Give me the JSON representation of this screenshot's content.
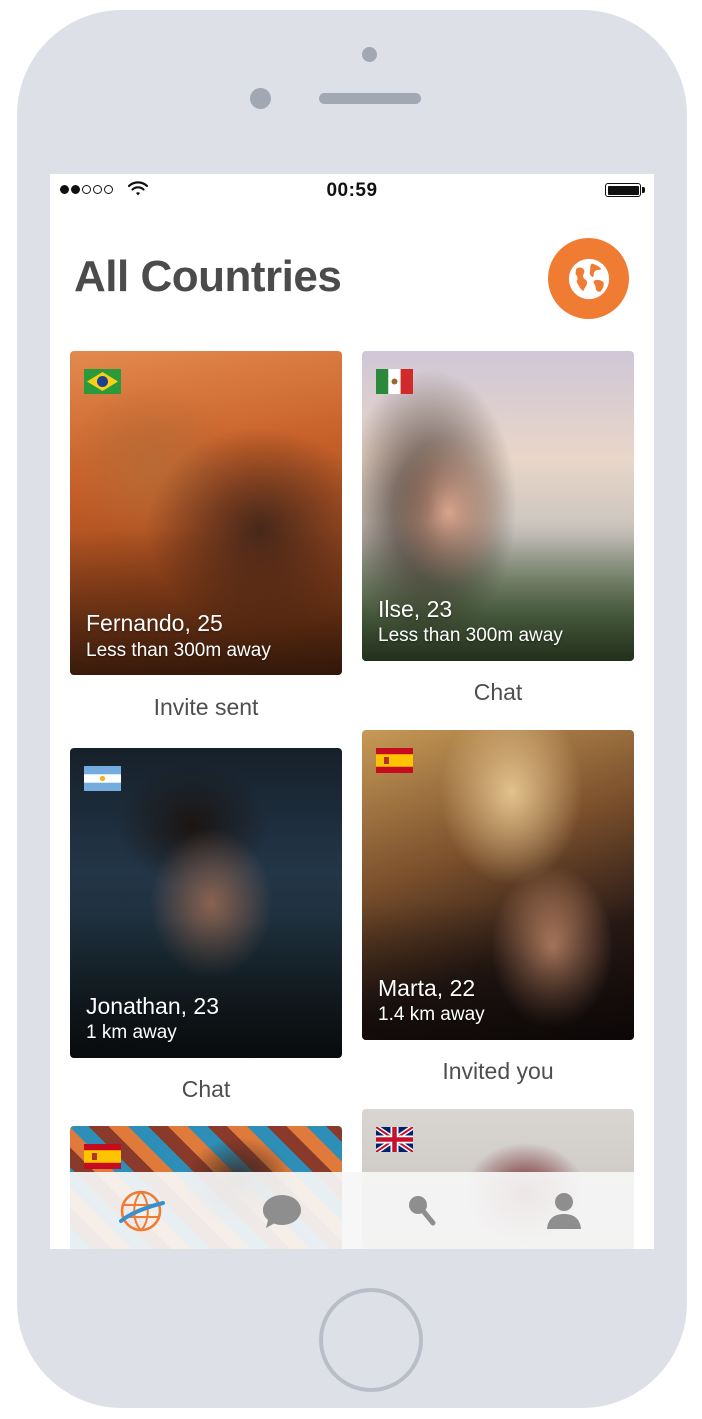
{
  "status_bar": {
    "time": "00:59"
  },
  "header": {
    "title": "All Countries",
    "globe_button_icon": "globe-icon",
    "accent_color": "#f07b32"
  },
  "profiles": [
    {
      "name_age": "Fernando, 25",
      "distance": "Less than 300m away",
      "flag": "brazil-flag",
      "action": "Invite sent"
    },
    {
      "name_age": "Ilse, 23",
      "distance": "Less than 300m away",
      "flag": "mexico-flag",
      "action": "Chat"
    },
    {
      "name_age": "Jonathan, 23",
      "distance": "1 km away",
      "flag": "argentina-flag",
      "action": "Chat"
    },
    {
      "name_age": "Marta, 22",
      "distance": "1.4 km away",
      "flag": "spain-flag",
      "action": "Invited you"
    },
    {
      "flag": "spain-flag"
    },
    {
      "flag": "uk-flag"
    }
  ],
  "tab_bar": {
    "tabs": [
      {
        "icon": "globe-tab-icon",
        "active": true
      },
      {
        "icon": "chat-bubble-icon",
        "active": false
      },
      {
        "icon": "search-icon",
        "active": false
      },
      {
        "icon": "profile-icon",
        "active": false
      }
    ]
  }
}
